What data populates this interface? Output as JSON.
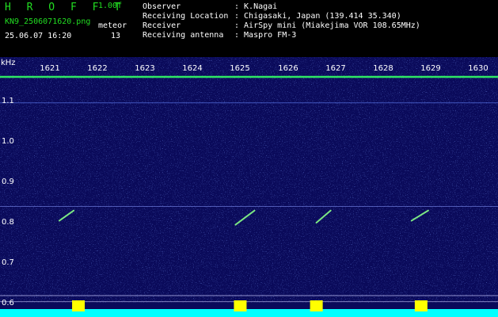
{
  "header": {
    "brand": "H R O F F T",
    "version": "1.00f",
    "filename": "KN9_2506071620.png",
    "meteor_label": "meteor",
    "datetime": "25.06.07 16:20",
    "meteor_count": "13"
  },
  "meta": [
    {
      "key": "Observer",
      "value": ": K.Nagai"
    },
    {
      "key": "Receiving Location",
      "value": ": Chigasaki, Japan (139.414 35.340)"
    },
    {
      "key": "Receiver",
      "value": ": AirSpy mini (Miakejima VOR 108.65MHz)"
    },
    {
      "key": "Receiving antenna",
      "value": ": Maspro FM-3"
    }
  ],
  "axis": {
    "unit": "kHz",
    "y_ticks": [
      "1.1",
      "1.0",
      "0.9",
      "0.8",
      "0.7",
      "0.6"
    ],
    "x_ticks": [
      "1621",
      "1622",
      "1623",
      "1624",
      "1625",
      "1626",
      "1627",
      "1628",
      "1629",
      "1630"
    ]
  },
  "colors": {
    "background": "#0a0a5a",
    "carrier": "#33ff66",
    "echo": "#88ff88",
    "power": "#00ffff",
    "burst": "#ffff00"
  },
  "chart_data": {
    "type": "heatmap",
    "title": "",
    "xlabel": "",
    "ylabel": "kHz",
    "x_range": [
      1620.8,
      1630.4
    ],
    "y_range": [
      0.59,
      1.17
    ],
    "echoes": [
      {
        "t_start": 1621.2,
        "t_end": 1621.5,
        "f_start": 0.805,
        "f_end": 0.83
      },
      {
        "t_start": 1624.9,
        "t_end": 1625.3,
        "f_start": 0.795,
        "f_end": 0.83
      },
      {
        "t_start": 1626.6,
        "t_end": 1626.9,
        "f_start": 0.8,
        "f_end": 0.83
      },
      {
        "t_start": 1628.6,
        "t_end": 1628.95,
        "f_start": 0.805,
        "f_end": 0.83
      }
    ],
    "bursts": [
      1621.6,
      1625.0,
      1626.6,
      1628.8
    ]
  }
}
